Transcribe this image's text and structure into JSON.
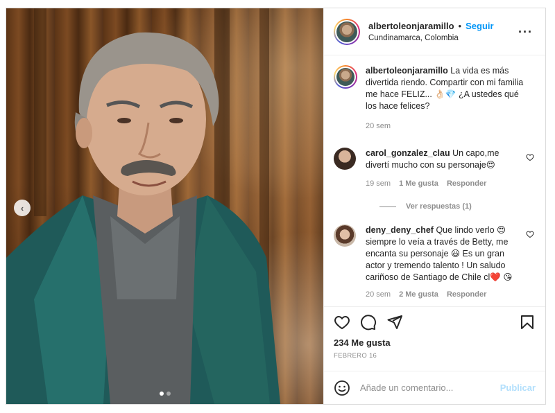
{
  "post": {
    "username": "albertoleonjaramillo",
    "separator": "•",
    "follow_label": "Seguir",
    "location": "Cundinamarca, Colombia",
    "more_icon": "more-horizontal-icon"
  },
  "caption": {
    "username": "albertoleonjaramillo",
    "text": "La vida es más divertida riendo. Compartir con mi familia me hace FELIZ... 👌🏻💎 ¿A ustedes qué los hace felices?",
    "time": "20 sem"
  },
  "comments": [
    {
      "username": "carol_gonzalez_clau",
      "text": "Un capo,me divertí mucho con su personaje😍",
      "time": "19 sem",
      "likes": "1 Me gusta",
      "reply_label": "Responder",
      "view_replies": "Ver respuestas (1)"
    },
    {
      "username": "deny_deny_chef",
      "text": "Que lindo verlo 😍 siempre lo veía a través de Betty, me encanta su personaje 😃 Es un gran actor y tremendo talento ! Un saludo cariñoso de Santiago de Chile cl❤️ 😘",
      "time": "20 sem",
      "likes": "2 Me gusta",
      "reply_label": "Responder"
    }
  ],
  "actions": {
    "likes": "234 Me gusta",
    "date": "FEBRERO 16"
  },
  "add_comment": {
    "placeholder": "Añade un comentario...",
    "publish_label": "Publicar"
  },
  "carousel": {
    "prev_label": "‹",
    "slide_count": 2,
    "active_slide": 1
  },
  "colors": {
    "accent": "#0095f6",
    "publish_disabled": "#b2dffc",
    "muted": "#8e8e8e"
  }
}
